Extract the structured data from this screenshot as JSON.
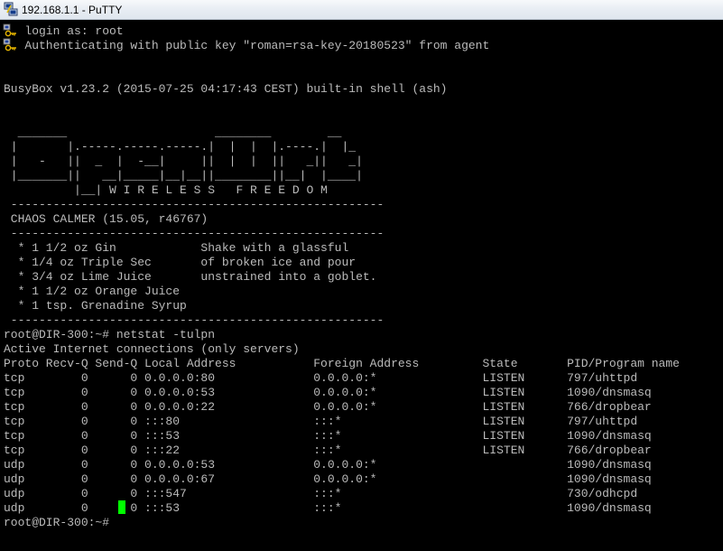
{
  "window": {
    "title": "192.168.1.1 - PuTTY",
    "colors": {
      "background": "#000000",
      "foreground": "#bbbbbb",
      "cursor": "#00ff00"
    },
    "app_icon": "putty-icon"
  },
  "terminal": {
    "lines": [
      "   login as: root",
      "   Authenticating with public key \"roman=rsa-key-20180523\" from agent",
      "",
      "",
      "BusyBox v1.23.2 (2015-07-25 04:17:43 CEST) built-in shell (ash)",
      "",
      "",
      "  _______                     ________        __",
      " |       |.-----.-----.-----.|  |  |  |.----.|  |_",
      " |   -   ||  _  |  -__|     ||  |  |  ||   _||   _|",
      " |_______||   __|_____|__|__||________||__|  |____|",
      "          |__| W I R E L E S S   F R E E D O M",
      " -----------------------------------------------------",
      " CHAOS CALMER (15.05, r46767)",
      " -----------------------------------------------------",
      "  * 1 1/2 oz Gin            Shake with a glassful",
      "  * 1/4 oz Triple Sec       of broken ice and pour",
      "  * 3/4 oz Lime Juice       unstrained into a goblet.",
      "  * 1 1/2 oz Orange Juice",
      "  * 1 tsp. Grenadine Syrup",
      " -----------------------------------------------------",
      "root@DIR-300:~# netstat -tulpn",
      "Active Internet connections (only servers)",
      "Proto Recv-Q Send-Q Local Address           Foreign Address         State       PID/Program name",
      "tcp        0      0 0.0.0.0:80              0.0.0.0:*               LISTEN      797/uhttpd",
      "tcp        0      0 0.0.0.0:53              0.0.0.0:*               LISTEN      1090/dnsmasq",
      "tcp        0      0 0.0.0.0:22              0.0.0.0:*               LISTEN      766/dropbear",
      "tcp        0      0 :::80                   :::*                    LISTEN      797/uhttpd",
      "tcp        0      0 :::53                   :::*                    LISTEN      1090/dnsmasq",
      "tcp        0      0 :::22                   :::*                    LISTEN      766/dropbear",
      "udp        0      0 0.0.0.0:53              0.0.0.0:*                           1090/dnsmasq",
      "udp        0      0 0.0.0.0:67              0.0.0.0:*                           1090/dnsmasq",
      "udp        0      0 :::547                  :::*                                730/odhcpd",
      "udp        0      0 :::53                   :::*                                1090/dnsmasq",
      "root@DIR-300:~# "
    ],
    "line_icons": [
      "key-icon",
      "key-icon"
    ]
  }
}
